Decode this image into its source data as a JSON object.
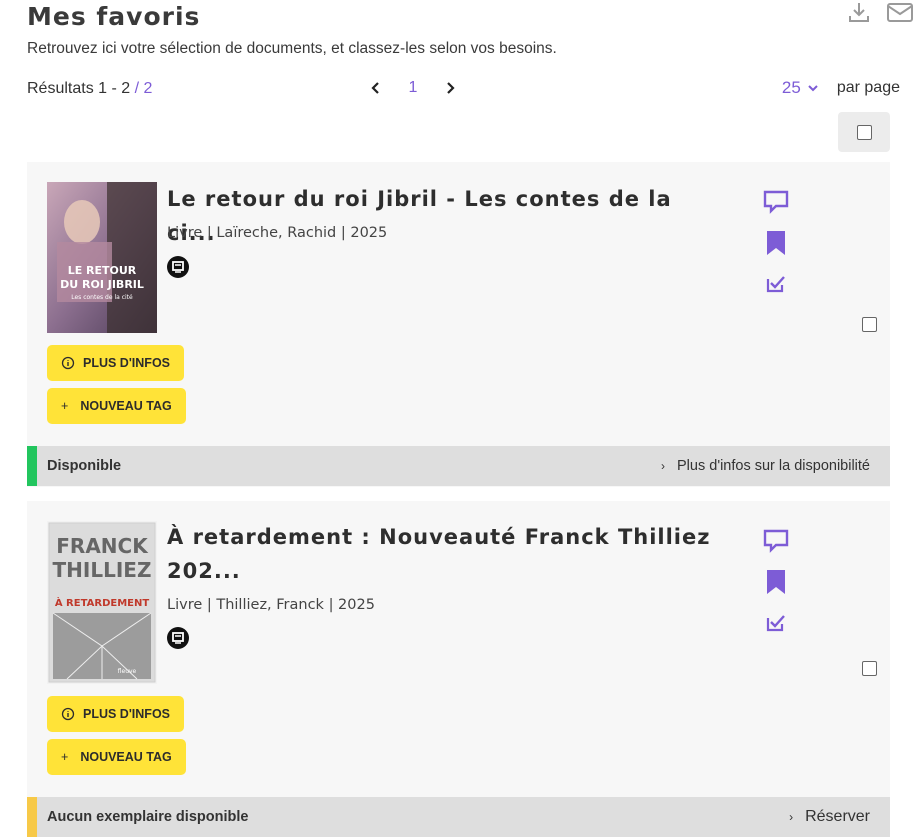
{
  "page": {
    "title": "Mes favoris",
    "subtitle": "Retrouvez ici votre sélection de documents, et classez-les selon vos besoins.",
    "results_prefix": "Résultats 1 - 2",
    "results_total": "/ 2",
    "current_page": "1",
    "per_page_value": "25",
    "per_page_label": "par page"
  },
  "icons": {
    "download": "download-icon",
    "mail": "mail-icon",
    "prev": "chevron-left-icon",
    "next": "chevron-right-icon",
    "dropdown": "chevron-down-icon"
  },
  "colors": {
    "accent": "#7d5cd6",
    "button_yellow": "#ffe338",
    "available_green": "#22c55e",
    "unavailable_yellow": "#f7c948"
  },
  "items": [
    {
      "title": "Le retour du roi Jibril - Les contes de la ci...",
      "meta": "Livre | Laïreche, Rachid | 2025",
      "more_info": "PLUS D'INFOS",
      "new_tag": "NOUVEAU TAG",
      "status": "Disponible",
      "status_link": "Plus d'infos sur la disponibilité",
      "cover_title_1": "LE RETOUR",
      "cover_title_2": "DU ROI JIBRIL",
      "cover_sub": "Les contes de la cité"
    },
    {
      "title": "À retardement : Nouveauté Franck Thilliez 202...",
      "meta": "Livre | Thilliez, Franck | 2025",
      "more_info": "PLUS D'INFOS",
      "new_tag": "NOUVEAU TAG",
      "status": "Aucun exemplaire disponible",
      "status_link": "Réserver",
      "cover_author_1": "FRANCK",
      "cover_author_2": "THILLIEZ",
      "cover_title": "À RETARDEMENT",
      "cover_publisher": "fleuve"
    }
  ]
}
